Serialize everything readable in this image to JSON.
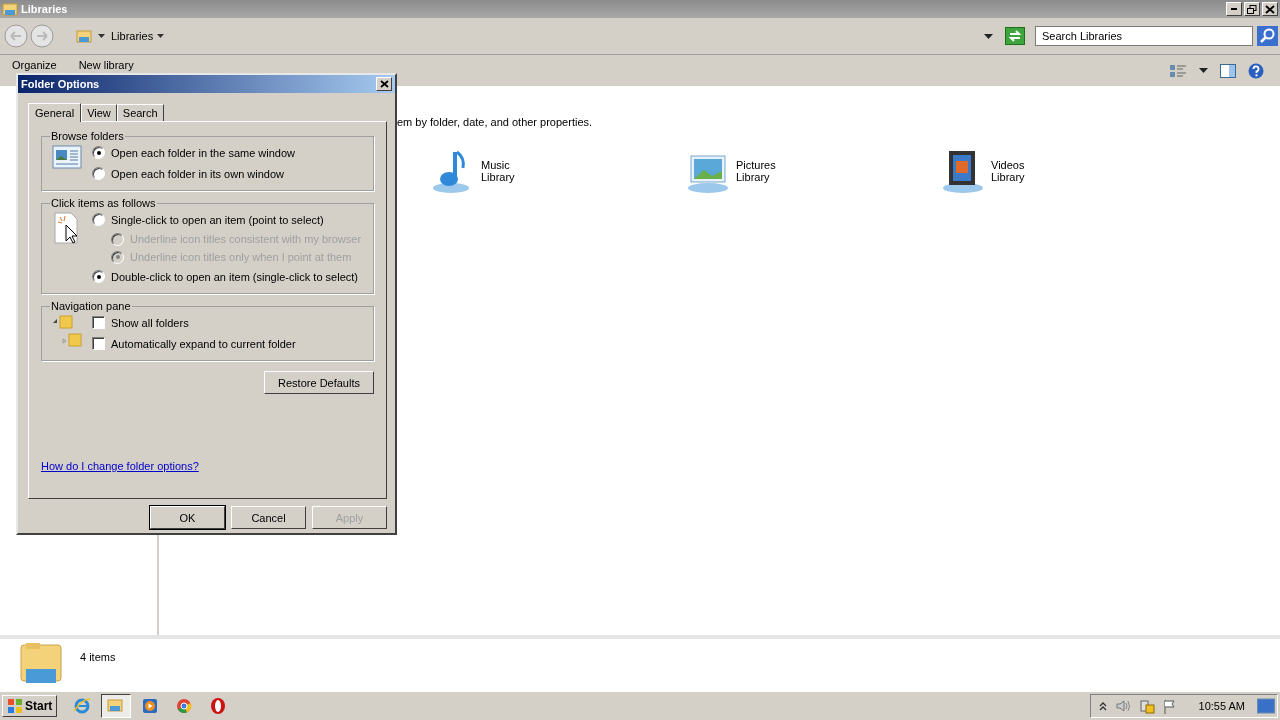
{
  "window": {
    "title": "Libraries"
  },
  "address_bar": {
    "path": "Libraries"
  },
  "search": {
    "placeholder": "Search Libraries"
  },
  "toolbar": {
    "items": [
      "Organize",
      "New library"
    ]
  },
  "content": {
    "description": "em by folder, date, and other properties.",
    "libraries": [
      {
        "kind": "music",
        "name": "Music",
        "label": "Library"
      },
      {
        "kind": "pictures",
        "name": "Pictures",
        "label": "Library"
      },
      {
        "kind": "videos",
        "name": "Videos",
        "label": "Library"
      }
    ]
  },
  "details_pane": {
    "count": "4 items"
  },
  "dialog": {
    "title": "Folder Options",
    "tabs": [
      {
        "label": "General",
        "selected": true
      },
      {
        "label": "View",
        "selected": false
      },
      {
        "label": "Search",
        "selected": false
      }
    ],
    "groups": [
      {
        "kind": "browse",
        "title": "Browse folders",
        "options": [
          {
            "kind": "radio",
            "label": "Open each folder in the same window",
            "checked": true,
            "disabled": false
          },
          {
            "kind": "radio",
            "label": "Open each folder in its own window",
            "checked": false,
            "disabled": false
          }
        ]
      },
      {
        "kind": "click",
        "title": "Click items as follows",
        "options": [
          {
            "kind": "radio",
            "label": "Single-click to open an item (point to select)",
            "checked": false,
            "disabled": false,
            "children": [
              {
                "kind": "radio",
                "label": "Underline icon titles consistent with my browser",
                "checked": false,
                "disabled": true
              },
              {
                "kind": "radio",
                "label": "Underline icon titles only when I point at them",
                "checked": true,
                "disabled": true
              }
            ]
          },
          {
            "kind": "radio",
            "label": "Double-click to open an item (single-click to select)",
            "checked": true,
            "disabled": false
          }
        ]
      },
      {
        "kind": "navigation",
        "title": "Navigation pane",
        "options": [
          {
            "kind": "checkbox",
            "label": "Show all folders",
            "checked": false,
            "disabled": false
          },
          {
            "kind": "checkbox",
            "label": "Automatically expand to current folder",
            "checked": false,
            "disabled": false
          }
        ]
      }
    ],
    "restore_button": "Restore Defaults",
    "help_link": "How do I change folder options?",
    "buttons": [
      {
        "label": "OK",
        "disabled": false
      },
      {
        "label": "Cancel",
        "disabled": false
      },
      {
        "label": "Apply",
        "disabled": true
      }
    ]
  },
  "taskbar": {
    "start": "Start",
    "apps": [
      {
        "kind": "ie",
        "selected": false
      },
      {
        "kind": "explorer",
        "selected": true
      },
      {
        "kind": "media",
        "selected": false
      },
      {
        "kind": "chrome",
        "selected": false
      },
      {
        "kind": "opera",
        "selected": false
      }
    ],
    "clock": "10:55 AM"
  }
}
